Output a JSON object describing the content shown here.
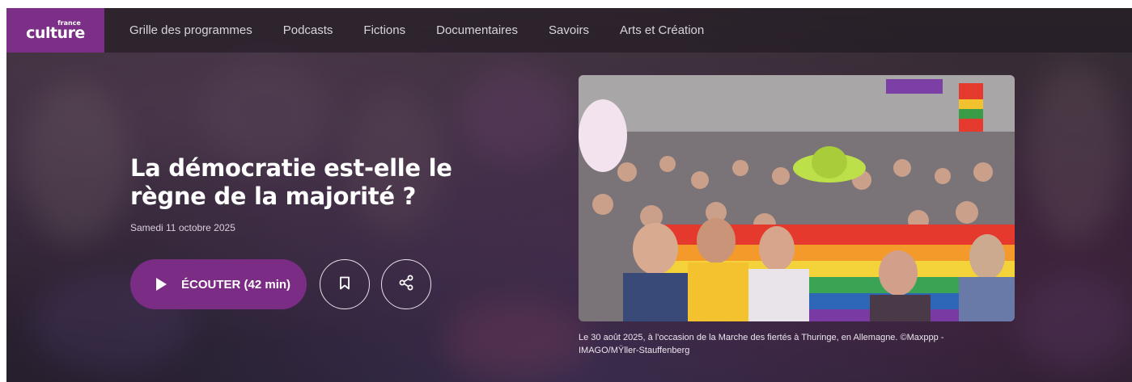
{
  "brand": {
    "logo_small": "france",
    "logo_big": "culture",
    "accent": "#7b2c84"
  },
  "nav": {
    "items": [
      {
        "label": "Grille des programmes"
      },
      {
        "label": "Podcasts"
      },
      {
        "label": "Fictions"
      },
      {
        "label": "Documentaires"
      },
      {
        "label": "Savoirs"
      },
      {
        "label": "Arts et Création"
      }
    ]
  },
  "episode": {
    "title": "La démocratie est-elle le règne de la majorité ?",
    "date": "Samedi 11 octobre 2025",
    "listen_label": "ÉCOUTER (42 min)",
    "bookmark_icon": "bookmark-icon",
    "share_icon": "share-icon"
  },
  "image": {
    "caption": "Le 30 août 2025, à l'occasion de la Marche des fiertés à Thuringe, en Allemagne. ©Maxppp - IMAGO/MŸller-Stauffenberg"
  }
}
